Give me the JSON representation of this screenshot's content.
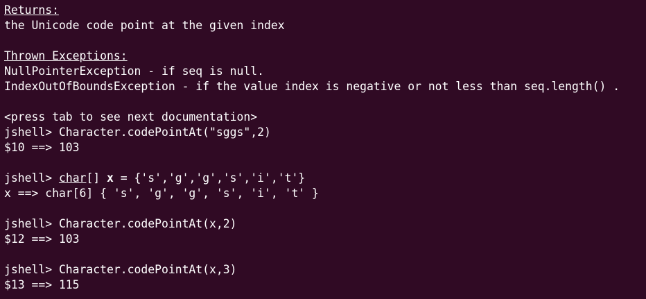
{
  "terminal": {
    "returns_heading": "Returns:",
    "returns_text": "the Unicode code point at the given index",
    "exceptions_heading": "Thrown Exceptions:",
    "exception_1": "NullPointerException - if seq is null.",
    "exception_2": "IndexOutOfBoundsException - if the value index is negative or not less than seq.length() .",
    "press_tab_hint": "<press tab to see next documentation>",
    "cmd_1": "jshell> Character.codePointAt(\"sggs\",2)",
    "out_1": "$10 ==> 103",
    "cmd_2": {
      "prompt": "jshell> ",
      "type_word": "char",
      "brackets": "[] ",
      "var_name": "x",
      "rest": " = {'s','g','g','s','i','t'}"
    },
    "out_2": "x ==> char[6] { 's', 'g', 'g', 's', 'i', 't' }",
    "cmd_3": "jshell> Character.codePointAt(x,2)",
    "out_3": "$12 ==> 103",
    "cmd_4": "jshell> Character.codePointAt(x,3)",
    "out_4": "$13 ==> 115"
  }
}
